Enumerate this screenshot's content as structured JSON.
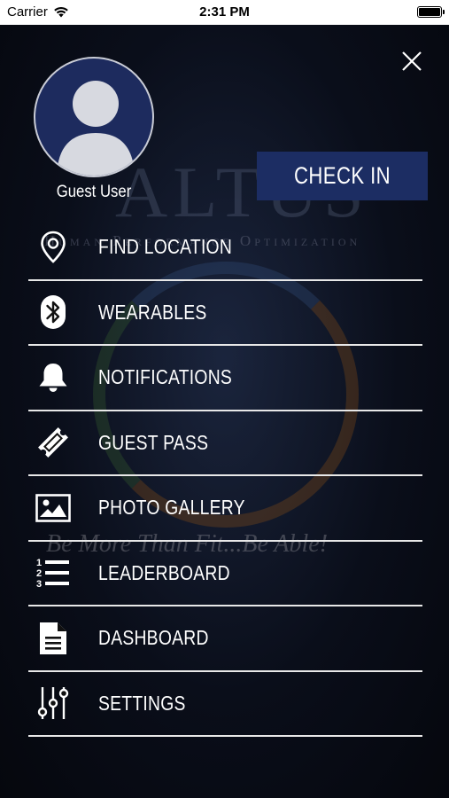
{
  "status_bar": {
    "carrier": "Carrier",
    "time": "2:31 PM"
  },
  "background": {
    "brand": "ALTUS",
    "tagline": "Human Performance Optimization",
    "motto": "Be More Than Fit...Be Able!"
  },
  "profile": {
    "name": "Guest User"
  },
  "check_in_label": "CHECK IN",
  "menu": {
    "items": [
      {
        "label": "FIND LOCATION",
        "icon": "map-pin-icon"
      },
      {
        "label": "WEARABLES",
        "icon": "bluetooth-icon"
      },
      {
        "label": "NOTIFICATIONS",
        "icon": "bell-icon"
      },
      {
        "label": "GUEST PASS",
        "icon": "ticket-icon"
      },
      {
        "label": "PHOTO GALLERY",
        "icon": "image-icon"
      },
      {
        "label": "LEADERBOARD",
        "icon": "ranked-list-icon"
      },
      {
        "label": "DASHBOARD",
        "icon": "document-icon"
      },
      {
        "label": "SETTINGS",
        "icon": "sliders-icon"
      }
    ]
  },
  "colors": {
    "accent": "#1c2d63",
    "avatar_bg": "#1d2b5e",
    "divider": "#e8e8e8",
    "text": "#ffffff"
  }
}
